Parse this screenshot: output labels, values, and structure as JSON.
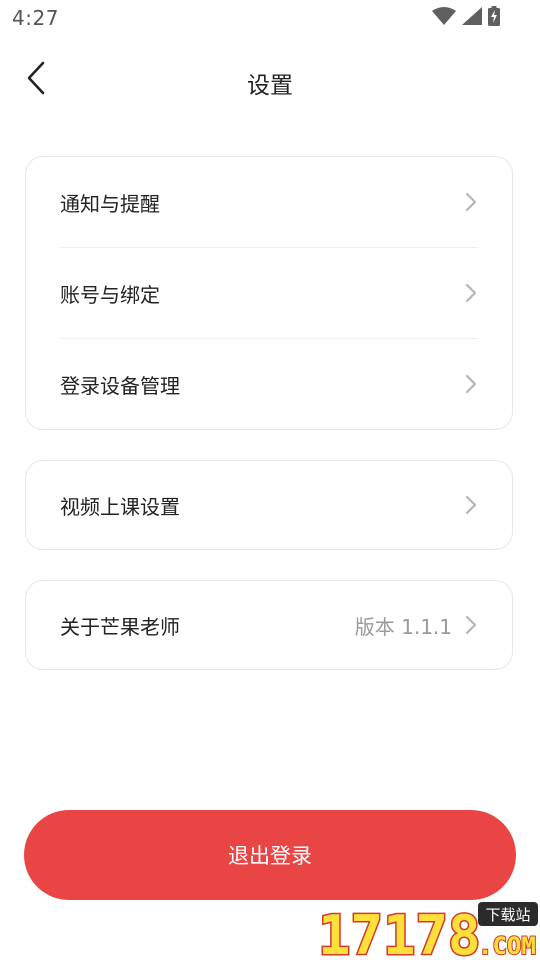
{
  "status_bar": {
    "time": "4:27",
    "icons": [
      "wifi-icon",
      "cell-signal-icon",
      "battery-charging-icon"
    ]
  },
  "header": {
    "title": "设置",
    "back_icon": "chevron-left-icon"
  },
  "groups": [
    {
      "items": [
        {
          "label": "通知与提醒",
          "value": ""
        },
        {
          "label": "账号与绑定",
          "value": ""
        },
        {
          "label": "登录设备管理",
          "value": ""
        }
      ]
    },
    {
      "items": [
        {
          "label": "视频上课设置",
          "value": ""
        }
      ]
    },
    {
      "items": [
        {
          "label": "关于芒果老师",
          "value": "版本 1.1.1"
        }
      ]
    }
  ],
  "logout": {
    "label": "退出登录",
    "color": "#ea4545"
  },
  "watermark": {
    "number": "17178",
    "tag": "下载站",
    "suffix": ".COM"
  },
  "colors": {
    "accent": "#ea4545",
    "chevron": "#b5b5b5",
    "card_border": "#e6e6e6",
    "secondary_text": "#9a9a9a"
  }
}
